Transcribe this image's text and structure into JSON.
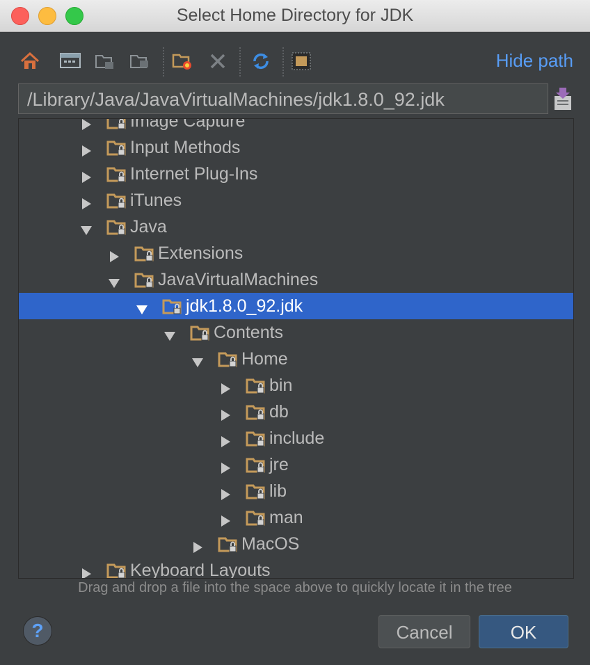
{
  "window": {
    "title": "Select Home Directory for JDK"
  },
  "toolbar": {
    "hide_path_label": "Hide path",
    "icons": [
      "home-icon",
      "desktop-icon",
      "project-folder-icon",
      "module-folder-icon",
      "new-folder-icon",
      "delete-icon",
      "refresh-icon",
      "show-hidden-icon"
    ]
  },
  "path": {
    "value": "/Library/Java/JavaVirtualMachines/jdk1.8.0_92.jdk"
  },
  "tree": {
    "rows": [
      {
        "label": "Image Capture",
        "depth": 0,
        "expanded": false
      },
      {
        "label": "Input Methods",
        "depth": 0,
        "expanded": false
      },
      {
        "label": "Internet Plug-Ins",
        "depth": 0,
        "expanded": false
      },
      {
        "label": "iTunes",
        "depth": 0,
        "expanded": false
      },
      {
        "label": "Java",
        "depth": 0,
        "expanded": true
      },
      {
        "label": "Extensions",
        "depth": 1,
        "expanded": false
      },
      {
        "label": "JavaVirtualMachines",
        "depth": 1,
        "expanded": true
      },
      {
        "label": "jdk1.8.0_92.jdk",
        "depth": 2,
        "expanded": true,
        "selected": true
      },
      {
        "label": "Contents",
        "depth": 3,
        "expanded": true
      },
      {
        "label": "Home",
        "depth": 4,
        "expanded": true
      },
      {
        "label": "bin",
        "depth": 5,
        "expanded": false
      },
      {
        "label": "db",
        "depth": 5,
        "expanded": false
      },
      {
        "label": "include",
        "depth": 5,
        "expanded": false
      },
      {
        "label": "jre",
        "depth": 5,
        "expanded": false
      },
      {
        "label": "lib",
        "depth": 5,
        "expanded": false
      },
      {
        "label": "man",
        "depth": 5,
        "expanded": false
      },
      {
        "label": "MacOS",
        "depth": 4,
        "expanded": false
      },
      {
        "label": "Keyboard Layouts",
        "depth": 0,
        "expanded": false
      }
    ]
  },
  "hint": "Drag and drop a file into the space above to quickly locate it in the tree",
  "footer": {
    "help_label": "?",
    "cancel_label": "Cancel",
    "ok_label": "OK"
  },
  "colors": {
    "background": "#3c3f41",
    "selection": "#2f65ca",
    "link": "#589df6",
    "folder": "#c49a5a"
  }
}
